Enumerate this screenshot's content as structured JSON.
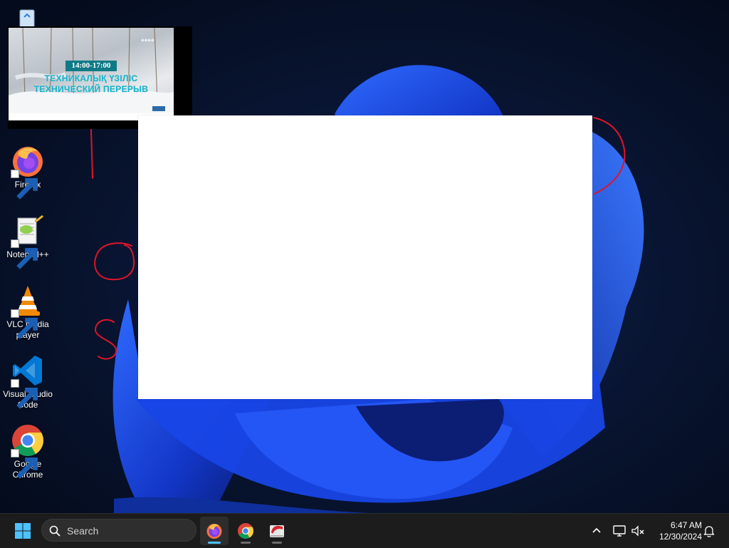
{
  "desktop": {
    "icons": [
      {
        "label": "Firefox",
        "icon": "firefox-icon"
      },
      {
        "label": "Notepad++",
        "icon": "notepadpp-icon"
      },
      {
        "label": "VLC media player",
        "icon": "vlc-icon"
      },
      {
        "label": "Visual Studio Code",
        "icon": "vscode-icon"
      },
      {
        "label": "Google Chrome",
        "icon": "chrome-icon"
      }
    ],
    "recycle_bin": {
      "icon": "recycle-bin-icon"
    }
  },
  "pip_window": {
    "time": "14:00-17:00",
    "line1": "ТЕХНИКАЛЫҚ ҮЗІЛІС",
    "line2": "ТЕХНИЧЕСКИЙ ПЕРЕРЫВ",
    "resize_icon": "resize-diagonal-icon"
  },
  "taskbar": {
    "start_icon": "windows-start-icon",
    "search": {
      "label": "Search",
      "icon": "search-icon"
    },
    "apps": [
      {
        "name": "Firefox",
        "icon": "firefox-icon",
        "active": true
      },
      {
        "name": "Google Chrome",
        "icon": "chrome-icon",
        "active": false
      },
      {
        "name": "Presentation app",
        "icon": "presentation-app-icon",
        "active": false
      }
    ],
    "tray": {
      "chevron_icon": "chevron-up-icon",
      "network_icon": "network-icon",
      "volume_icon": "volume-muted-icon",
      "notifications_icon": "bell-icon"
    },
    "clock": {
      "time": "6:47 AM",
      "date": "12/30/2024"
    }
  },
  "colors": {
    "taskbar_bg": "#1c1c1c",
    "accent": "#4cc2ff",
    "annotation_ink": "#e0142a",
    "wallpaper_blue": "#1c4de0"
  }
}
